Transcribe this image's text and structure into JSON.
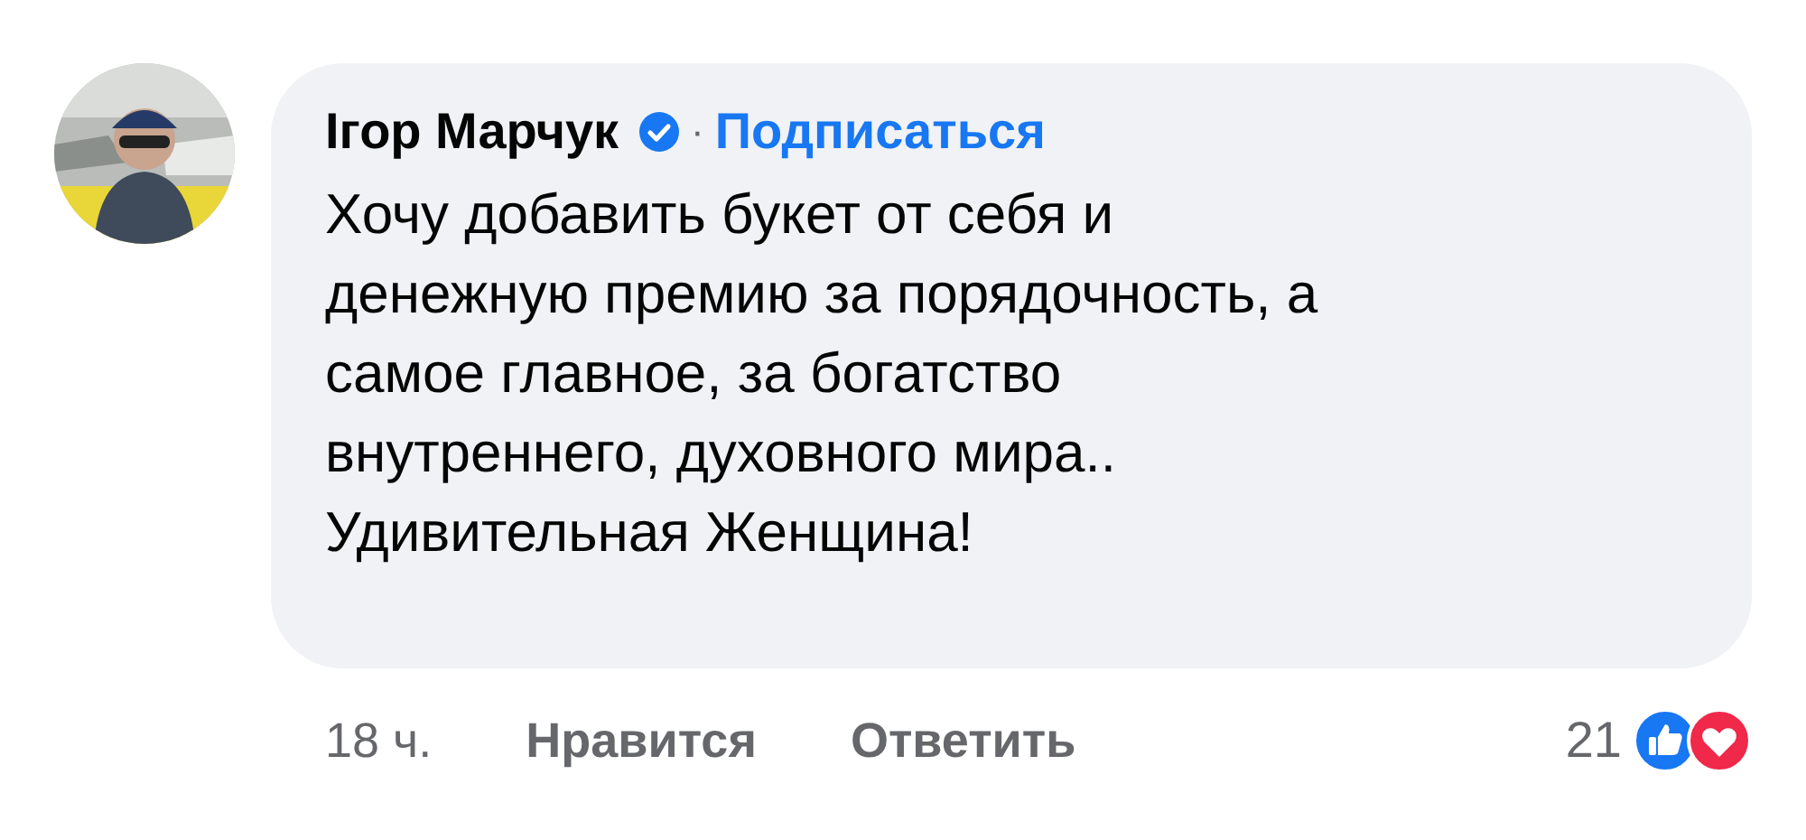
{
  "comment": {
    "author": "Ігор Марчук",
    "verified": true,
    "follow_link": "Подписаться",
    "separator": "·",
    "text": "Хочу добавить букет от себя и\nденежную премию за порядочность, а\nсамое главное, за богатство\nвнутреннего, духовного мира..\nУдивительная Женщина!"
  },
  "actions": [
    {
      "label": "18 ч.",
      "kind": "time"
    },
    {
      "label": "Нравится",
      "kind": "link"
    },
    {
      "label": "Ответить",
      "kind": "link"
    }
  ],
  "reactions": {
    "count": "21",
    "icons": [
      {
        "kind": "like"
      },
      {
        "kind": "love"
      }
    ]
  }
}
